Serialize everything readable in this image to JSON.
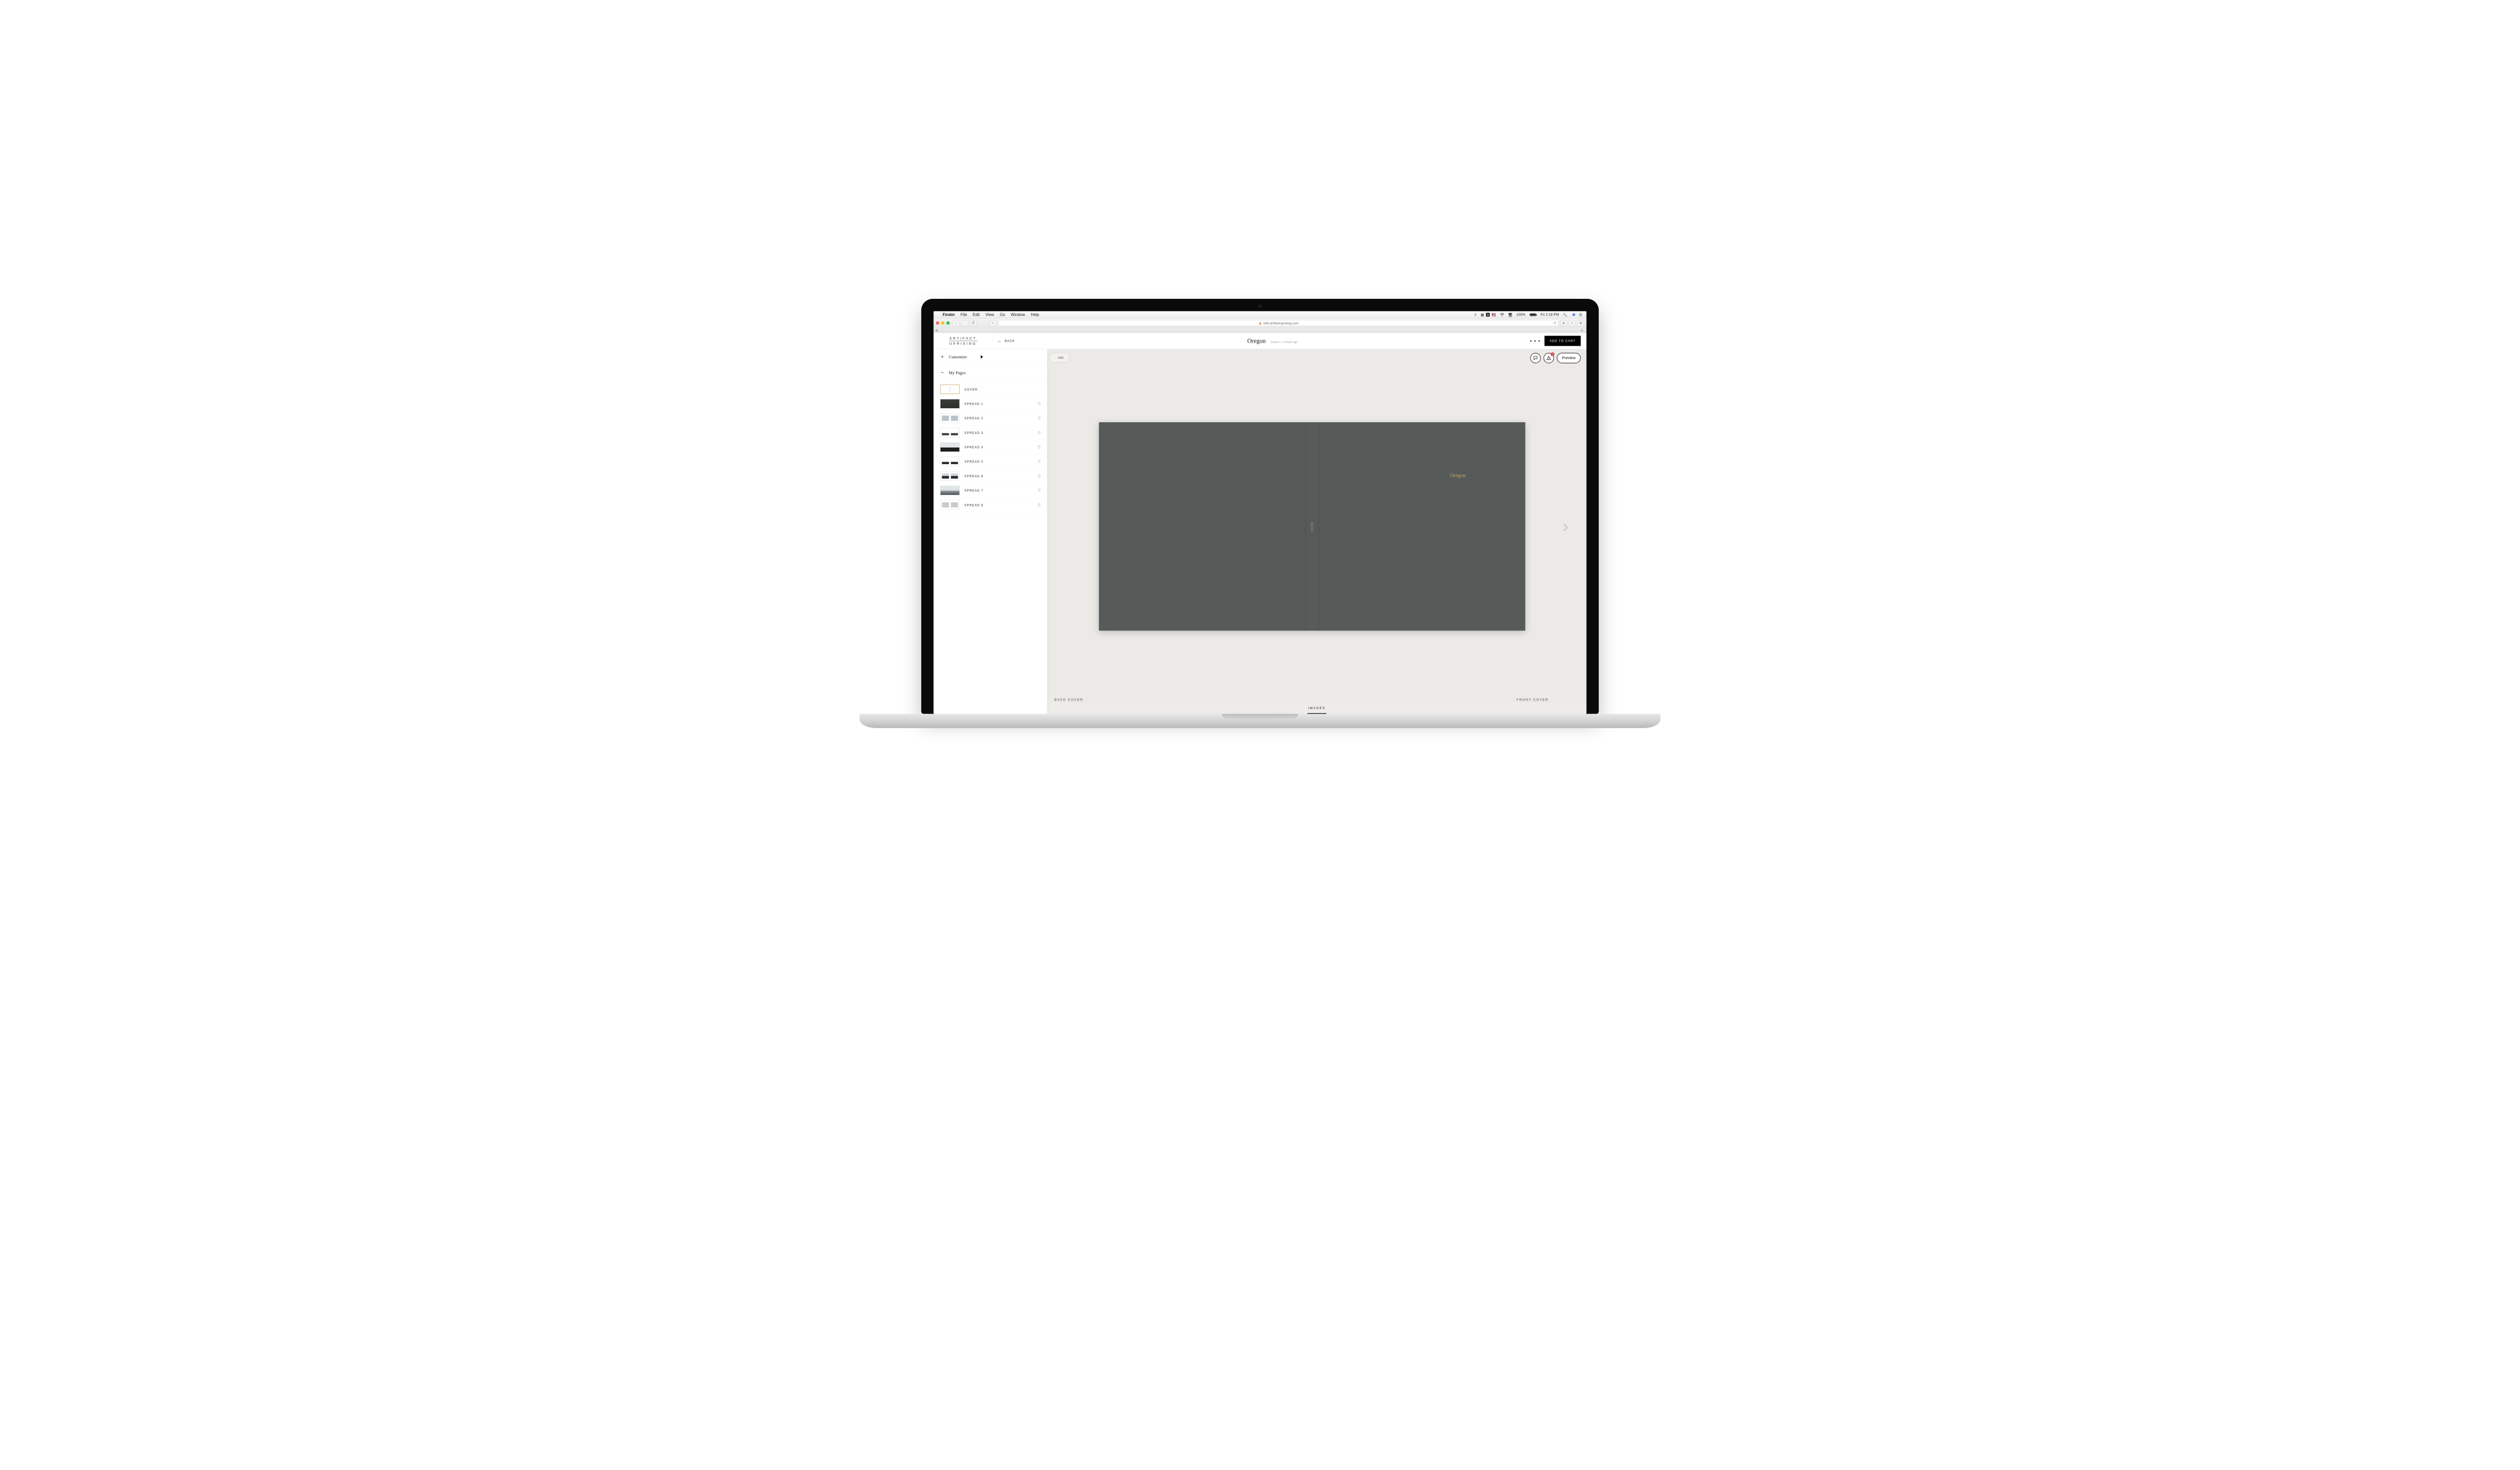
{
  "menubar": {
    "app": "Finder",
    "items": [
      "File",
      "Edit",
      "View",
      "Go",
      "Window",
      "Help"
    ],
    "battery_pct": "100%",
    "clock": "Fri 2:18 PM"
  },
  "safari": {
    "url": "edit.artifactuprising.com",
    "sidebar_glyph": "☰"
  },
  "brand": {
    "line1": "ARTIFACT",
    "line2": "UPRISING"
  },
  "header": {
    "back_label": "BACK",
    "project_title": "Oregon",
    "saved_status": "Saved • 1 minute ago",
    "more_glyph": "• • •",
    "add_to_cart": "ADD TO CART"
  },
  "sidebar": {
    "customize": "Customize",
    "my_pages": "My Pages",
    "pages": [
      {
        "label": "COVER"
      },
      {
        "label": "SPREAD 1"
      },
      {
        "label": "SPREAD 2"
      },
      {
        "label": "SPREAD 3"
      },
      {
        "label": "SPREAD 4"
      },
      {
        "label": "SPREAD 5"
      },
      {
        "label": "SPREAD 6"
      },
      {
        "label": "SPREAD 7"
      },
      {
        "label": "SPREAD 8"
      }
    ]
  },
  "canvas": {
    "redo_label": "edo",
    "preview_label": "Preview",
    "warning_count": "1",
    "book_title": "Oregon",
    "spine_text": "2020",
    "back_cover_label": "BACK COVER",
    "front_cover_label": "FRONT COVER",
    "images_label": "IMAGES"
  }
}
